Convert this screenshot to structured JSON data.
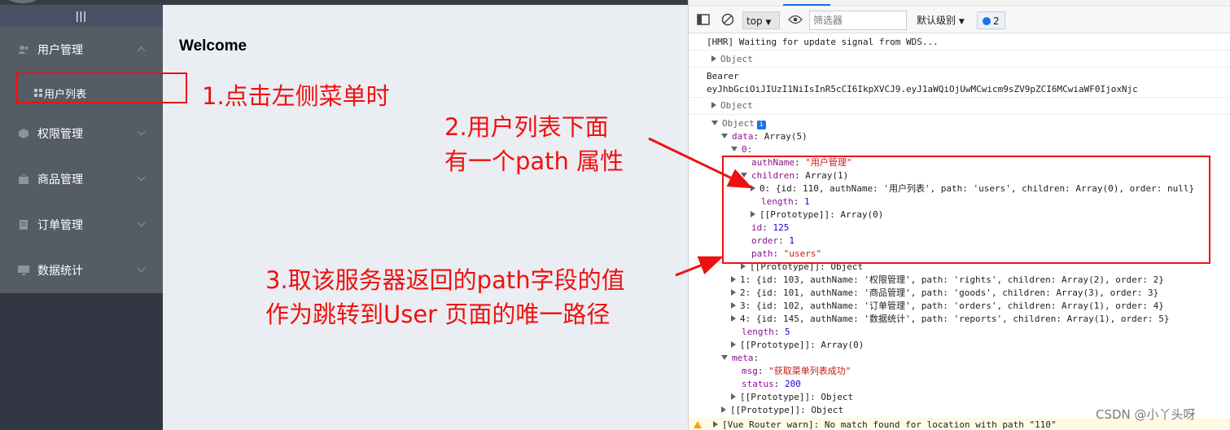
{
  "app": {
    "toggle": "|||",
    "welcome": "Welcome",
    "menu": [
      {
        "label": "用户管理",
        "icon": "users-icon",
        "expanded": true
      },
      {
        "label": "权限管理",
        "icon": "box-icon",
        "expanded": false
      },
      {
        "label": "商品管理",
        "icon": "bag-icon",
        "expanded": false
      },
      {
        "label": "订单管理",
        "icon": "document-icon",
        "expanded": false
      },
      {
        "label": "数据统计",
        "icon": "monitor-icon",
        "expanded": false
      }
    ],
    "submenu_item": "用户列表"
  },
  "devtools": {
    "top_select": "top",
    "filter_placeholder": "筛选器",
    "level": "默认级别",
    "badge_count": "2",
    "lines": {
      "hmr": "[HMR] Waiting for update signal from WDS...",
      "object1": "Object",
      "bearer": "Bearer",
      "token": "eyJhbGciOiJIUzI1NiIsInR5cCI6IkpXVCJ9.eyJ1aWQiOjUwMCwicm9sZV9pZCI6MCwiaWF0IjoxNjc",
      "object2": "Object",
      "object3": "Object",
      "data_key": "data",
      "data_val": "Array(5)",
      "idx0": "0:",
      "authName_key": "authName",
      "authName_val": "\"用户管理\"",
      "children_key": "children",
      "children_val": "Array(1)",
      "child0": "0: {id: 110, authName: '用户列表', path: 'users', children: Array(0), order: null}",
      "length_key": "length",
      "length_val": "1",
      "proto0": "[[Prototype]]: Array(0)",
      "id_key": "id",
      "id_val": "125",
      "order_key": "order",
      "order_val": "1",
      "path_key": "path",
      "path_val": "\"users\"",
      "proto_obj": "[[Prototype]]: Object",
      "item1": "1: {id: 103, authName: '权限管理', path: 'rights', children: Array(2), order: 2}",
      "item2": "2: {id: 101, authName: '商品管理', path: 'goods', children: Array(3), order: 3}",
      "item3": "3: {id: 102, authName: '订单管理', path: 'orders', children: Array(1), order: 4}",
      "item4": "4: {id: 145, authName: '数据统计', path: 'reports', children: Array(1), order: 5}",
      "length5_key": "length",
      "length5_val": "5",
      "proto_arr": "[[Prototype]]: Array(0)",
      "meta_key": "meta",
      "msg_key": "msg",
      "msg_val": "\"获取菜单列表成功\"",
      "status_key": "status",
      "status_val": "200",
      "proto_meta": "[[Prototype]]: Object",
      "proto_root": "[[Prototype]]: Object",
      "warn": "[Vue Router warn]: No match found for location with path \"110\""
    }
  },
  "annotations": {
    "note1": "1.点击左侧菜单时",
    "note2_line1": "2.用户列表下面",
    "note2_line2": "有一个path 属性",
    "note3_line1": "3.取该服务器返回的path字段的值",
    "note3_line2": "作为跳转到User 页面的唯一路径"
  },
  "watermark": "CSDN @小丫头呀",
  "colors": {
    "annotation": "#ee1111",
    "sidebar": "#545c64",
    "main_bg": "#eaedf1"
  }
}
